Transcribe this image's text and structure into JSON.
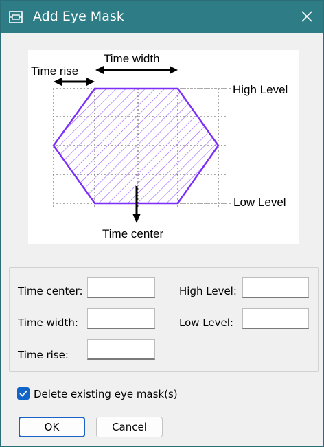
{
  "window": {
    "title": "Add Eye Mask",
    "title_bar_color": "#2d7c86",
    "app_icon": "eye-mask-dialog-icon",
    "close_icon": "close-icon"
  },
  "diagram": {
    "labels": {
      "time_width": "Time width",
      "time_rise": "Time rise",
      "high_level": "High Level",
      "low_level": "Low Level",
      "time_center": "Time center"
    },
    "mask_color": "#7b2ff7"
  },
  "form": {
    "time_center": {
      "label": "Time center:",
      "value": ""
    },
    "time_width": {
      "label": "Time width:",
      "value": ""
    },
    "time_rise": {
      "label": "Time rise:",
      "value": ""
    },
    "high_level": {
      "label": "High Level:",
      "value": ""
    },
    "low_level": {
      "label": "Low Level:",
      "value": ""
    }
  },
  "delete_existing": {
    "label": "Delete existing eye mask(s)",
    "checked": true
  },
  "buttons": {
    "ok": "OK",
    "cancel": "Cancel"
  }
}
